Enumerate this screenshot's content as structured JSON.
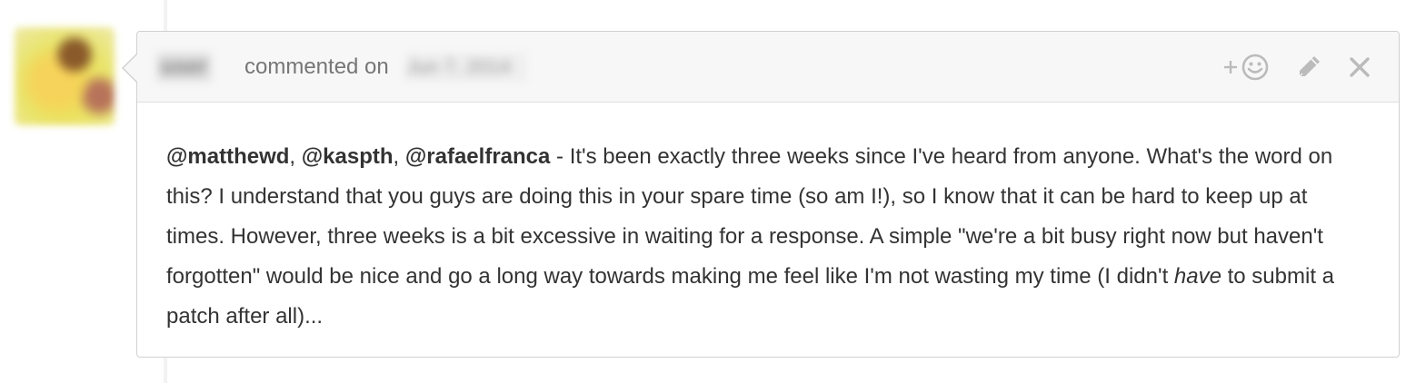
{
  "author": {
    "name": "user",
    "commented_text": "commented on",
    "date": "Jun 7, 2014"
  },
  "actions": {
    "reaction_icon": "add-reaction-icon",
    "edit_icon": "pencil-icon",
    "delete_icon": "close-icon"
  },
  "body": {
    "mentions": [
      "@matthewd",
      "@kaspth",
      "@rafaelfranca"
    ],
    "separator_1": ", ",
    "separator_2": ", ",
    "text_1": " - It's been exactly three weeks since I've heard from anyone. What's the word on this? I understand that you guys are doing this in your spare time (so am I!), so I know that it can be hard to keep up at times. However, three weeks is a bit excessive in waiting for a response. A simple \"we're a bit busy right now but haven't forgotten\" would be nice and go a long way towards making me feel like I'm not wasting my time (I didn't ",
    "emphasis": "have",
    "text_2": " to submit a patch after all)..."
  },
  "colors": {
    "header_bg": "#f7f7f7",
    "border": "#d1d1d1",
    "icon": "#bbbbbb",
    "text": "#333333"
  }
}
